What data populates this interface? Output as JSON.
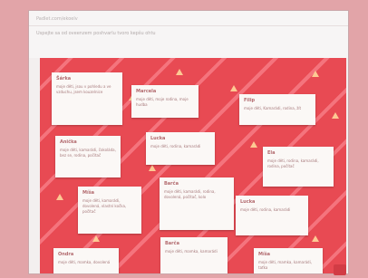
{
  "header": {
    "title": "Padlet.com/ekoelv",
    "subtitle": "Uspejte sa od oveenzem poshvarlu tvoro kepšu ohtu"
  },
  "colors": {
    "board_bg": "#e84a53",
    "card_bg": "#fbf8f6",
    "frame_bg": "#d9959a",
    "accent": "#d23c45"
  },
  "cards": [
    {
      "name": "Šárka",
      "text": "moje děti, jsou v pohledu a ve vzduchu, jsem kouzelnice"
    },
    {
      "name": "Marcela",
      "text": "moje děti, moje rodina, moje hudba"
    },
    {
      "name": "Filip",
      "text": "moje děti, Kamarádi, rodina, žít"
    },
    {
      "name": "Anička",
      "text": "moje děti, kamarádi, čokoláda, bez se, rodina, počítač"
    },
    {
      "name": "Lucka",
      "text": "moje děti, rodina, kamarádi"
    },
    {
      "name": "Ela",
      "text": "moje děti, rodina, kamarádi, rodina, počítač"
    },
    {
      "name": "Míša",
      "text": "moje děti, kamarádi, dovolená, vlastní kočka, počítač"
    },
    {
      "name": "Barča",
      "text": "moje děti, kamarádi, rodina, dovolená, počítač, kolo"
    },
    {
      "name": "Lucka",
      "text": "moje děti, rodina, kamarádi"
    },
    {
      "name": "Ondra",
      "text": "moje děti, mamka, dovolená"
    },
    {
      "name": "Barča",
      "text": "moje děti, mamka, kamarádi"
    },
    {
      "name": "Míša",
      "text": "moje děti, mamka, kamarádi, taťka"
    }
  ]
}
